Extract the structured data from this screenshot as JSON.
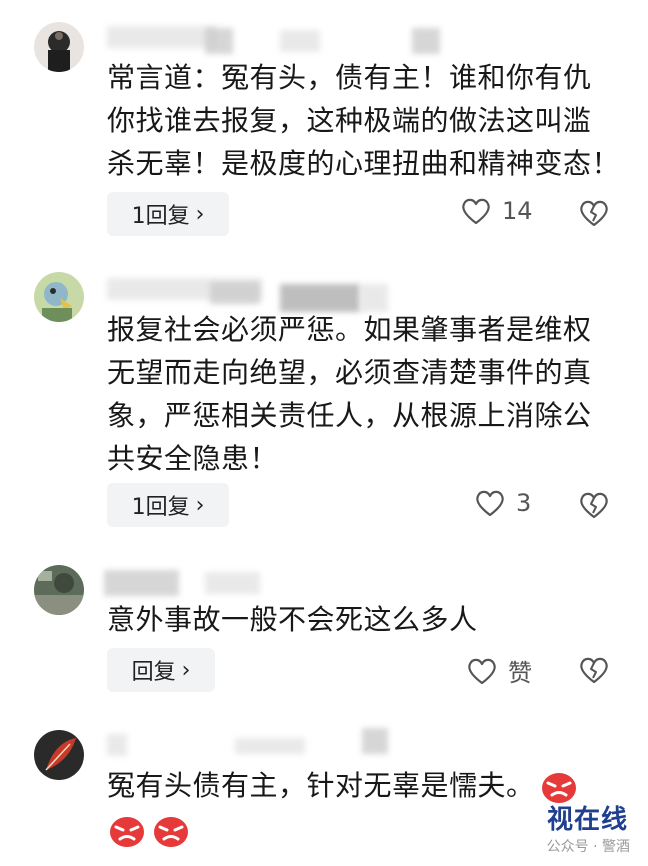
{
  "comments": [
    {
      "text": "常言道：冤有头，债有主！谁和你有仇\n你找谁去报复，这种极端的做法这叫滥\n杀无辜！是极度的心理扭曲和精神变态！",
      "reply_label": "1回复",
      "like_count": "14"
    },
    {
      "text": "报复社会必须严惩。如果肇事者是维权\n无望而走向绝望，必须查清楚事件的真\n象，严惩相关责任人，从根源上消除公\n共安全隐患！",
      "reply_label": "1回复",
      "like_count": "3"
    },
    {
      "text": "意外事故一般不会死这么多人",
      "reply_label": "回复",
      "like_count": "赞"
    },
    {
      "text": "冤有头债有主，针对无辜是懦夫。"
    }
  ],
  "watermark": {
    "logo_text": "视在线",
    "caption": "公众号 · 警酒"
  },
  "icons": {
    "like": "heart-outline-icon",
    "dislike": "broken-heart-icon",
    "chevron": "chevron-right-icon",
    "emoji": "angry-face-emoji"
  },
  "colors": {
    "reply_bg": "#f2f3f5",
    "icon_gray": "#555555",
    "emoji_red": "#e63a3a"
  }
}
